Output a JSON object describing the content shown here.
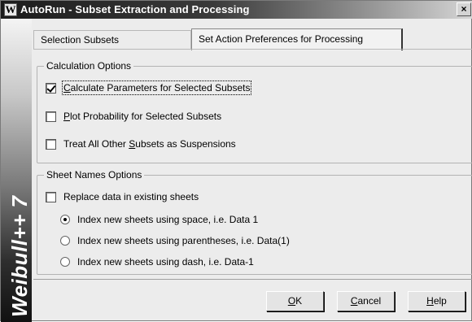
{
  "window": {
    "logo_letter": "W",
    "title": "AutoRun - Subset Extraction and Processing",
    "close_glyph": "×"
  },
  "banner": {
    "text": "Weibull++ 7"
  },
  "tabs": [
    {
      "label": "Selection Subsets",
      "active": false
    },
    {
      "label": "Set Action Preferences for Processing",
      "active": true
    }
  ],
  "calculation_options": {
    "legend": "Calculation Options",
    "items": [
      {
        "pre": "",
        "mnemonic": "C",
        "post": "alculate Parameters for Selected Subsets",
        "checked": true
      },
      {
        "pre": "",
        "mnemonic": "P",
        "post": "lot Probability for Selected Subsets",
        "checked": false
      },
      {
        "pre": "Treat All Other ",
        "mnemonic": "S",
        "post": "ubsets as Suspensions",
        "checked": false
      }
    ]
  },
  "sheet_names_options": {
    "legend": "Sheet Names Options",
    "replace_label": "Replace data in existing sheets",
    "replace_checked": false,
    "radios": [
      {
        "label": "Index new sheets using space, i.e. Data 1",
        "selected": true
      },
      {
        "label": "Index new sheets using parentheses, i.e. Data(1)",
        "selected": false
      },
      {
        "label": "Index new sheets using dash, i.e. Data-1",
        "selected": false
      }
    ]
  },
  "buttons": {
    "ok": {
      "mnemonic": "O",
      "rest": "K"
    },
    "cancel": {
      "mnemonic": "C",
      "rest": "ancel"
    },
    "help": {
      "mnemonic": "H",
      "rest": "elp"
    }
  }
}
